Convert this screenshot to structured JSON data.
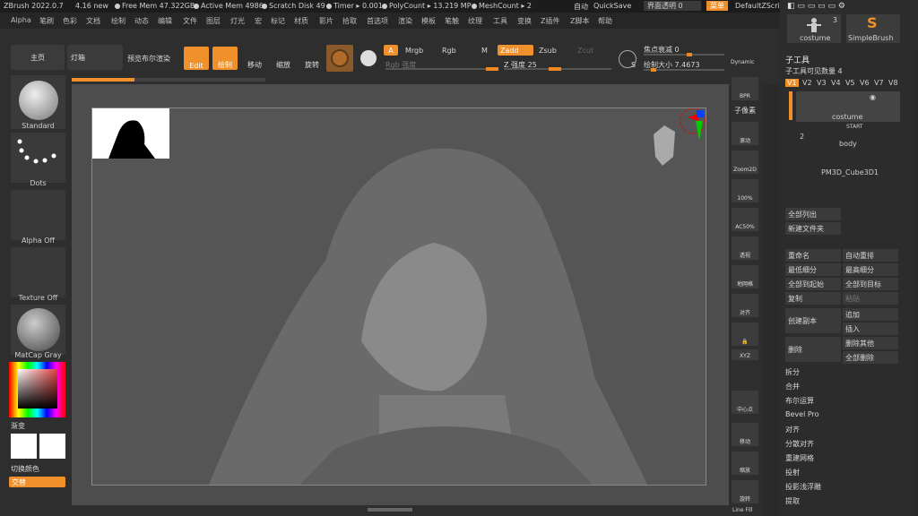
{
  "colors": {
    "accent": "#f0902a",
    "bg": "#2a2a2a",
    "viewport": "#4d4d4d"
  },
  "topbar": {
    "app": "ZBrush 2022.0.7",
    "ver": "4.16 new",
    "free_mem": "Free Mem 47.322GB",
    "active_mem": "Active Mem 4986",
    "scratch": "Scratch Disk 49",
    "timer": "Timer ▸ 0.001",
    "polycount": "PolyCount ▸ 13.219 MP",
    "meshcount": "MeshCount ▸ 2",
    "auto": "自动",
    "quicksave": "QuickSave",
    "transparency": "界面透明 0",
    "menu": "菜单",
    "script": "DefaultZScript"
  },
  "menu": [
    "Alpha",
    "笔刷",
    "色彩",
    "文档",
    "绘制",
    "动态",
    "编辑",
    "文件",
    "图层",
    "灯光",
    "宏",
    "标记",
    "材质",
    "影片",
    "拾取",
    "首选项",
    "渲染",
    "模板",
    "笔触",
    "纹理",
    "工具",
    "变换",
    "Z插件",
    "Z脚本",
    "帮助"
  ],
  "ctrl": {
    "home": "主页",
    "lightbox": "灯箱",
    "preview": "预览布尔渲染",
    "edit": "Edit",
    "draw": "绘制",
    "move": "移动",
    "scale": "缩放",
    "rotate": "旋转",
    "a": "A",
    "mrgb": "Mrgb",
    "rgb": "Rgb",
    "m": "M",
    "zadd": "Zadd",
    "zsub": "Zsub",
    "zcut": "Zcut",
    "rgb_strength": "Rgb 强度",
    "z_strength": "Z 强度 25",
    "focal": "焦点衰减 0",
    "draw_size": "绘制大小 7.4673",
    "dynamic": "Dynamic",
    "s_label": "S"
  },
  "left": {
    "brush": "Standard",
    "stroke": "Dots",
    "alpha": "Alpha Off",
    "texture": "Texture Off",
    "material": "MatCap Gray",
    "gradient": "渐变",
    "switch": "切换颜色",
    "alternate": "交替"
  },
  "right": [
    "BPR",
    "子像素",
    "滚动",
    "Zoom2D",
    "100%",
    "AC50%",
    "透视",
    "地网格",
    "对齐",
    "",
    "XYZ",
    "",
    "",
    "中心点",
    "移动",
    "缩放",
    "旋转",
    "Line Fill"
  ],
  "toolpanel": {
    "costume_count": "3",
    "costume": "costume",
    "simplebrush": "SimpleBrush",
    "header": "子工具",
    "visible": "子工具可见数量 4",
    "versions": [
      "V1",
      "V2",
      "V3",
      "V4",
      "V5",
      "V6",
      "V7",
      "V8"
    ],
    "items": [
      "costume",
      "body",
      "PM3D_Cube3D1"
    ],
    "start": "START",
    "item2_num": "2",
    "list_all": "全部列出",
    "new_folder": "新建文件夹",
    "rename": "重命名",
    "autoreorder": "自动重排",
    "lowest": "最低细分",
    "highest": "最高细分",
    "all_low": "全部到起始",
    "all_high": "全部到目标",
    "copy": "复制",
    "paste": "粘贴",
    "dup": "创建副本",
    "append": "追加",
    "insert": "插入",
    "delete": "删除",
    "del_other": "删除其他",
    "del_all": "全部删除",
    "split": "拆分",
    "merge": "合并",
    "boolean": "布尔运算",
    "bevel": "Bevel Pro",
    "align": "对齐",
    "distribute": "分散对齐",
    "remesh": "重建网格",
    "project": "投射",
    "project_relief": "投影浅浮雕",
    "extract": "提取"
  }
}
